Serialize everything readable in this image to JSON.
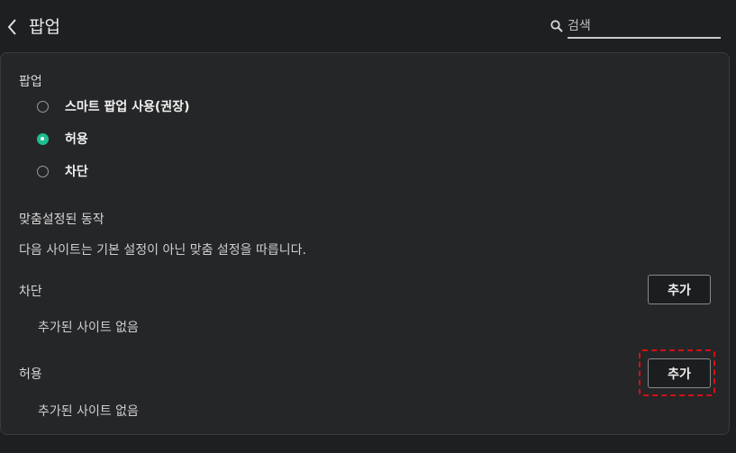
{
  "header": {
    "title": "팝업",
    "back_icon": "chevron-left-icon",
    "search": {
      "placeholder": "검색",
      "value": "",
      "icon": "search-icon"
    }
  },
  "popups": {
    "section_label": "팝업",
    "options": [
      {
        "label": "스마트 팝업 사용(권장)",
        "checked": false
      },
      {
        "label": "허용",
        "checked": true
      },
      {
        "label": "차단",
        "checked": false
      }
    ]
  },
  "custom": {
    "heading": "맞춤설정된 동작",
    "description": "다음 사이트는 기본 설정이 아닌 맞춤 설정을 따릅니다.",
    "block": {
      "label": "차단",
      "add_label": "추가",
      "empty_text": "추가된 사이트 없음"
    },
    "allow": {
      "label": "허용",
      "add_label": "추가",
      "empty_text": "추가된 사이트 없음"
    }
  },
  "colors": {
    "accent": "#1fbf8f",
    "highlight": "#d60f14",
    "background": "#1e1f21"
  }
}
